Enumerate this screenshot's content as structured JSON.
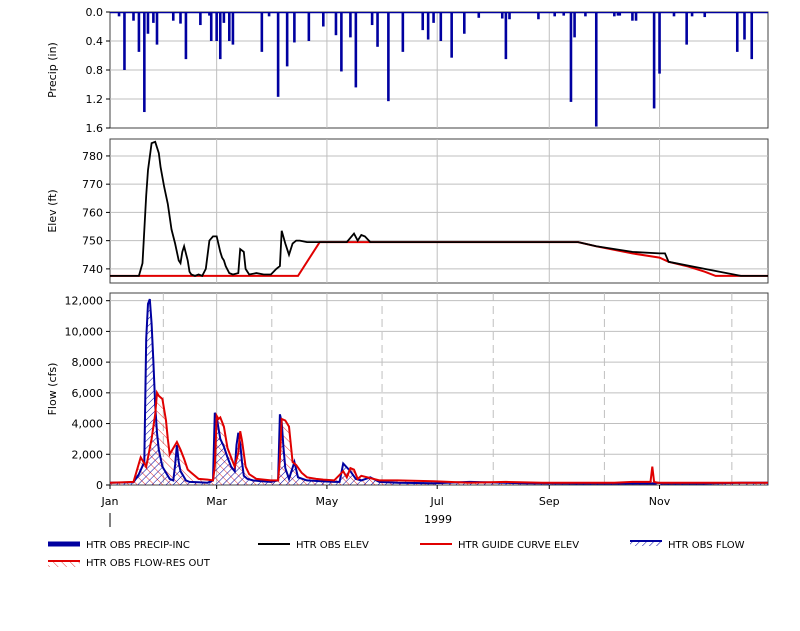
{
  "colors": {
    "precip": "#0000a0",
    "obs_elev": "#000000",
    "guide_curve": "#e00000",
    "obs_flow": "#0000a0",
    "res_out": "#e00000",
    "grid": "#bfbfbf",
    "frame": "#404040"
  },
  "chart_data": [
    {
      "type": "bar",
      "panel": "precip",
      "ylabel": "Precip (in)",
      "ylim": [
        0,
        1.6
      ],
      "y_inverted": true,
      "y_ticks": [
        "0.0",
        "0.4",
        "0.8",
        "1.2",
        "1.6"
      ],
      "x_unit": "day of year 1999",
      "xlim": [
        1,
        365
      ],
      "grid": true,
      "series": [
        {
          "name": "HTR OBS PRECIP-INC",
          "x": [
            6,
            9,
            14,
            17,
            20,
            22,
            25,
            27,
            36,
            40,
            43,
            51,
            56,
            57,
            60,
            62,
            64,
            67,
            69,
            85,
            89,
            94,
            99,
            103,
            111,
            119,
            126,
            129,
            134,
            137,
            146,
            149,
            155,
            163,
            174,
            177,
            180,
            184,
            190,
            197,
            205,
            218,
            220,
            222,
            238,
            247,
            252,
            256,
            258,
            264,
            270,
            280,
            282,
            283,
            290,
            292,
            302,
            305,
            313,
            320,
            323,
            330,
            348,
            352,
            356
          ],
          "y": [
            0.06,
            0.8,
            0.12,
            0.55,
            1.38,
            0.3,
            0.15,
            0.45,
            0.12,
            0.16,
            0.65,
            0.18,
            0.05,
            0.4,
            0.4,
            0.65,
            0.15,
            0.4,
            0.45,
            0.55,
            0.06,
            1.17,
            0.75,
            0.42,
            0.4,
            0.2,
            0.32,
            0.82,
            0.35,
            1.04,
            0.18,
            0.48,
            1.23,
            0.55,
            0.25,
            0.38,
            0.15,
            0.4,
            0.63,
            0.3,
            0.08,
            0.09,
            0.65,
            0.1,
            0.1,
            0.06,
            0.05,
            1.24,
            0.35,
            0.06,
            1.58,
            0.06,
            0.05,
            0.05,
            0.12,
            0.12,
            1.33,
            0.85,
            0.06,
            0.45,
            0.06,
            0.07,
            0.55,
            0.38,
            0.65
          ]
        }
      ]
    },
    {
      "type": "line",
      "panel": "elevation",
      "ylabel": "Elev (ft)",
      "ylim": [
        735,
        786
      ],
      "y_ticks": [
        "740",
        "750",
        "760",
        "770",
        "780"
      ],
      "x_unit": "day of year 1999",
      "xlim": [
        1,
        365
      ],
      "grid": true,
      "series": [
        {
          "name": "HTR OBS ELEV",
          "x": [
            1,
            17,
            19,
            21,
            22,
            24,
            26,
            28,
            29,
            31,
            33,
            35,
            37,
            39,
            40,
            41,
            42,
            44,
            45,
            46,
            48,
            50,
            52,
            54,
            56,
            58,
            60,
            62,
            63,
            64,
            65,
            67,
            69,
            72,
            73,
            75,
            76,
            78,
            82,
            86,
            90,
            93,
            95,
            96,
            98,
            100,
            102,
            104,
            106,
            110,
            115,
            118,
            123,
            132,
            136,
            138,
            140,
            142,
            145,
            170,
            200,
            230,
            260,
            270,
            290,
            305,
            308,
            310,
            330,
            350,
            365
          ],
          "y": [
            737.5,
            737.5,
            742,
            766,
            775,
            784.5,
            785,
            781,
            776,
            769,
            763,
            754,
            749,
            743,
            742,
            746,
            748,
            743,
            739,
            738,
            737.5,
            738,
            737.5,
            740,
            750,
            751.5,
            751.5,
            746,
            744,
            743,
            741,
            738.5,
            738,
            738.5,
            747,
            746,
            740,
            738,
            738.5,
            738,
            738,
            740,
            741,
            753.5,
            749,
            745,
            749,
            750,
            750,
            749.5,
            749.5,
            749.5,
            749.5,
            749.5,
            752.5,
            750,
            752,
            751.5,
            749.5,
            749.5,
            749.5,
            749.5,
            749.5,
            748,
            746,
            745.5,
            745.5,
            742.5,
            740,
            737.5,
            737.5
          ]
        },
        {
          "name": "HTR GUIDE CURVE ELEV",
          "x": [
            1,
            105,
            117,
            240,
            260,
            270,
            290,
            305,
            310,
            320,
            330,
            336,
            345,
            365
          ],
          "y": [
            737.5,
            737.5,
            749.5,
            749.5,
            749.5,
            748,
            745.5,
            744,
            742.5,
            741,
            739,
            737.5,
            737.5,
            737.5
          ]
        }
      ]
    },
    {
      "type": "area",
      "panel": "flow",
      "ylabel": "Flow (cfs)",
      "ylim": [
        0,
        12500
      ],
      "y_ticks": [
        "0",
        "2,000",
        "4,000",
        "6,000",
        "8,000",
        "10,000",
        "12,000"
      ],
      "x_ticks": [
        "Jan",
        "Mar",
        "May",
        "Jul",
        "Sep",
        "Nov"
      ],
      "x_tick_days": [
        1,
        60,
        121,
        182,
        244,
        305
      ],
      "year_label": "1999",
      "xlim": [
        1,
        365
      ],
      "grid": true,
      "series": [
        {
          "name": "HTR OBS FLOW",
          "x": [
            1,
            14,
            17,
            20,
            21,
            22,
            23,
            24,
            25,
            26,
            27,
            28,
            30,
            32,
            34,
            36,
            37,
            38,
            39,
            40,
            41,
            42,
            43,
            45,
            50,
            55,
            58,
            59,
            60,
            62,
            64,
            66,
            68,
            70,
            71,
            72,
            73,
            74,
            75,
            77,
            80,
            85,
            90,
            94,
            95,
            96,
            97,
            98,
            100,
            103,
            105,
            110,
            118,
            125,
            128,
            130,
            134,
            137,
            140,
            145,
            150,
            160,
            180,
            200,
            230,
            260,
            280,
            300,
            303,
            304,
            306,
            310,
            330,
            350,
            365
          ],
          "y": [
            150,
            180,
            700,
            1500,
            9500,
            11800,
            12100,
            10500,
            8000,
            5200,
            3400,
            2300,
            1200,
            800,
            400,
            300,
            1300,
            2600,
            1500,
            900,
            700,
            500,
            300,
            200,
            180,
            150,
            300,
            4700,
            4400,
            3000,
            2500,
            1800,
            1200,
            900,
            2600,
            3400,
            2700,
            1500,
            600,
            400,
            300,
            250,
            200,
            300,
            4600,
            4100,
            2400,
            1100,
            400,
            1500,
            500,
            300,
            250,
            200,
            200,
            1400,
            900,
            400,
            300,
            500,
            200,
            150,
            120,
            200,
            120,
            100,
            100,
            100,
            100,
            150,
            100,
            100,
            100,
            150,
            150
          ]
        },
        {
          "name": "HTR OBS FLOW-RES OUT",
          "x": [
            1,
            14,
            18,
            21,
            22,
            24,
            26,
            27,
            28,
            30,
            32,
            33,
            34,
            36,
            38,
            40,
            42,
            44,
            46,
            50,
            55,
            58,
            59,
            60,
            61,
            62,
            64,
            66,
            68,
            70,
            72,
            73,
            74,
            76,
            78,
            82,
            86,
            90,
            94,
            95,
            96,
            98,
            100,
            102,
            104,
            107,
            110,
            115,
            119,
            125,
            130,
            132,
            134,
            136,
            138,
            140,
            145,
            150,
            160,
            180,
            200,
            220,
            240,
            260,
            280,
            290,
            300,
            301,
            302,
            304,
            320,
            340,
            365
          ],
          "y": [
            150,
            200,
            1800,
            1200,
            1800,
            3000,
            4600,
            6000,
            5800,
            5600,
            4200,
            3000,
            2000,
            2400,
            2800,
            2300,
            1700,
            1000,
            800,
            400,
            350,
            300,
            1200,
            4500,
            4300,
            4400,
            3800,
            2400,
            1800,
            1200,
            2100,
            3500,
            2900,
            1200,
            700,
            400,
            350,
            300,
            300,
            1700,
            4300,
            4200,
            3800,
            1500,
            1300,
            800,
            500,
            400,
            350,
            300,
            900,
            500,
            1100,
            1000,
            400,
            600,
            450,
            300,
            300,
            250,
            150,
            200,
            150,
            150,
            150,
            200,
            200,
            1200,
            200,
            150,
            150,
            150,
            150
          ]
        }
      ]
    }
  ],
  "legend": {
    "items": [
      {
        "name": "HTR OBS PRECIP-INC"
      },
      {
        "name": "HTR OBS ELEV"
      },
      {
        "name": "HTR GUIDE CURVE ELEV"
      },
      {
        "name": "HTR OBS FLOW"
      },
      {
        "name": "HTR OBS FLOW-RES OUT"
      }
    ]
  }
}
